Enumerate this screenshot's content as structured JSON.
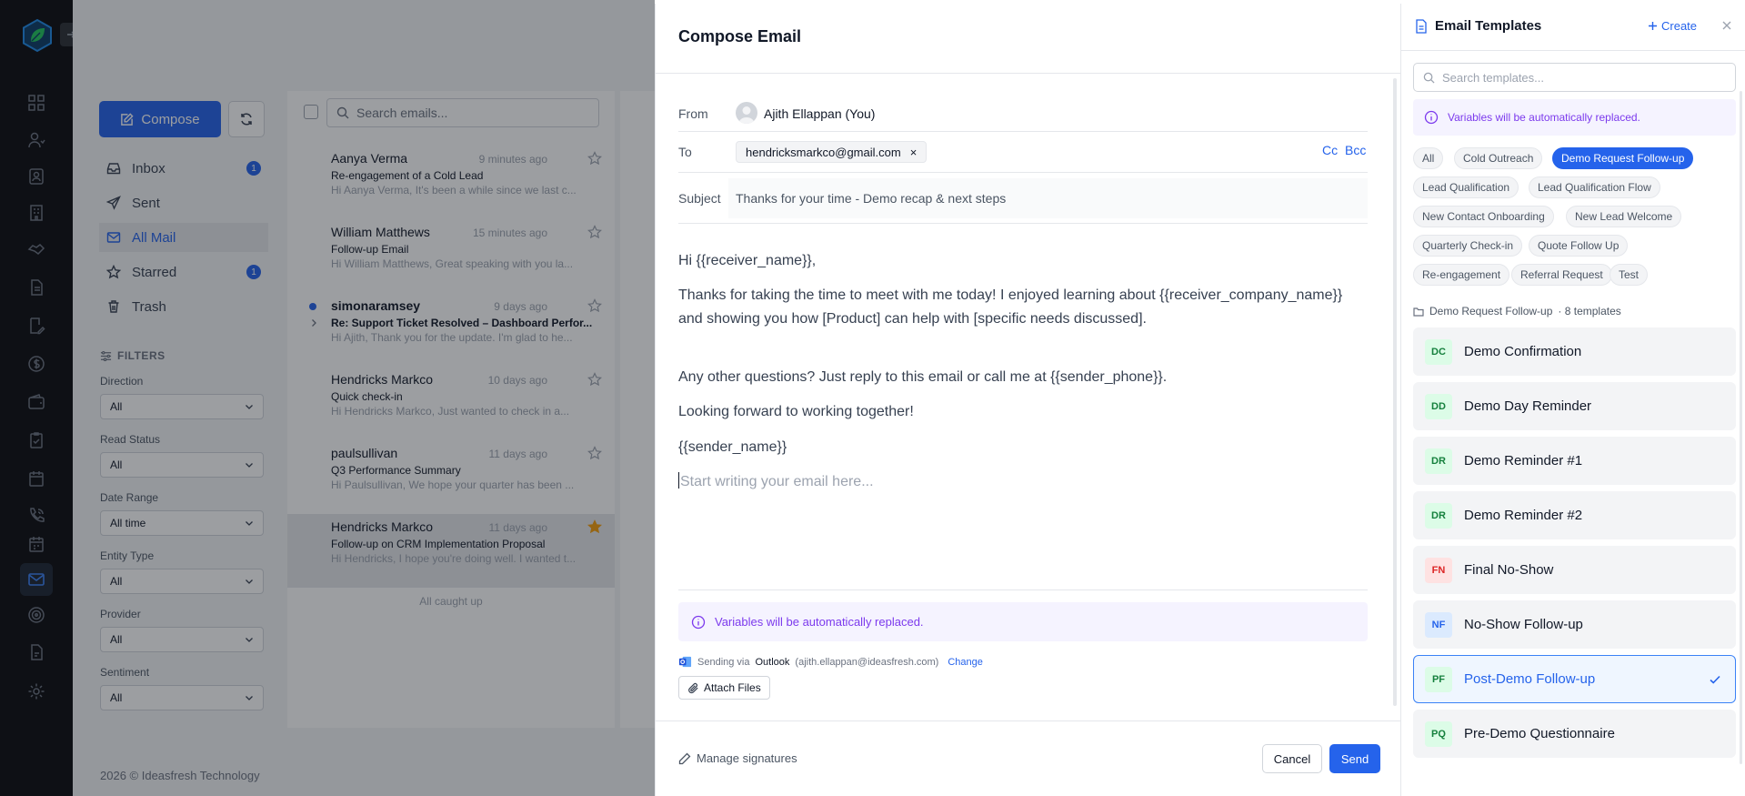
{
  "sidebar": {
    "compose_label": "Compose",
    "nav": [
      {
        "label": "Inbox",
        "badge": "1"
      },
      {
        "label": "Sent",
        "badge": ""
      },
      {
        "label": "All Mail",
        "badge": ""
      },
      {
        "label": "Starred",
        "badge": "1"
      },
      {
        "label": "Trash",
        "badge": ""
      }
    ],
    "filters_heading": "FILTERS",
    "filters": [
      {
        "label": "Direction",
        "value": "All"
      },
      {
        "label": "Read Status",
        "value": "All"
      },
      {
        "label": "Date Range",
        "value": "All time"
      },
      {
        "label": "Entity Type",
        "value": "All"
      },
      {
        "label": "Provider",
        "value": "All"
      },
      {
        "label": "Sentiment",
        "value": "All"
      }
    ],
    "footer": "2026 ©  Ideasfresh Technology"
  },
  "mail_list": {
    "search_placeholder": "Search emails...",
    "items": [
      {
        "from": "Aanya Verma",
        "time": "9 minutes ago",
        "subject": "Re-engagement of a Cold Lead",
        "preview": "Hi Aanya Verma, It's been a while since we last c...",
        "unread": false,
        "starred": false
      },
      {
        "from": "William Matthews",
        "time": "15 minutes ago",
        "subject": "Follow-up Email",
        "preview": "Hi William Matthews, Great speaking with you la...",
        "unread": false,
        "starred": false
      },
      {
        "from": "simonaramsey",
        "time": "9 days ago",
        "subject": "Re: Support Ticket Resolved – Dashboard Perfor...",
        "preview": "Hi Ajith, Thank you for the update. I'm glad to he...",
        "unread": true,
        "starred": false
      },
      {
        "from": "Hendricks Markco",
        "time": "10 days ago",
        "subject": "Quick check-in",
        "preview": "Hi Hendricks Markco, Just wanted to check in a...",
        "unread": false,
        "starred": false
      },
      {
        "from": "paulsullivan",
        "time": "11 days ago",
        "subject": "Q3 Performance Summary",
        "preview": "Hi Paulsullivan, We hope your quarter has been ...",
        "unread": false,
        "starred": false
      },
      {
        "from": "Hendricks Markco",
        "time": "11 days ago",
        "subject": "Follow-up on CRM Implementation Proposal",
        "preview": "Hi Hendricks, I hope you're doing well. I wanted t...",
        "unread": false,
        "starred": true
      }
    ],
    "end_text": "All caught up"
  },
  "compose": {
    "title": "Compose Email",
    "from_label": "From",
    "from_value": "Ajith Ellappan (You)",
    "to_label": "To",
    "to_chip": "hendricksmarkco@gmail.com",
    "chip_remove": "×",
    "cc_label": "Cc",
    "bcc_label": "Bcc",
    "subject_label": "Subject",
    "subject_value": "Thanks for your time - Demo recap & next steps",
    "body": [
      "Hi {{receiver_name}},",
      "Thanks for taking the time to meet with me today! I enjoyed learning about {{receiver_company_name}} and showing you how [Product] can help with [specific needs discussed].",
      "Any other questions? Just reply to this email or call me at {{sender_phone}}.",
      "Looking forward to working together!",
      "{{sender_name}}"
    ],
    "body_placeholder": "Start writing your email here...",
    "variables_note": "Variables will be automatically replaced.",
    "sending_prefix": "Sending via",
    "sending_provider": "Outlook",
    "sending_account": "(ajith.ellappan@ideasfresh.com)",
    "change_label": "Change",
    "attach_label": "Attach Files",
    "manage_signatures": "Manage signatures",
    "cancel_label": "Cancel",
    "send_label": "Send"
  },
  "templates": {
    "title": "Email Templates",
    "create_label": "Create",
    "search_placeholder": "Search templates...",
    "variables_note": "Variables will be automatically replaced.",
    "categories": [
      "All",
      "Cold Outreach",
      "Demo Request Follow-up",
      "Lead Qualification",
      "Lead Qualification Flow",
      "New Contact Onboarding",
      "New Lead Welcome",
      "Quarterly Check-in",
      "Quote Follow Up",
      "Re-engagement",
      "Referral Request",
      "Test"
    ],
    "active_category": "Demo Request Follow-up",
    "crumb_category": "Demo Request Follow-up",
    "crumb_count": "· 8 templates",
    "items": [
      {
        "initials": "DC",
        "name": "Demo Confirmation",
        "color": "#15803d",
        "bg": "#dcfce7"
      },
      {
        "initials": "DD",
        "name": "Demo Day Reminder",
        "color": "#15803d",
        "bg": "#dcfce7"
      },
      {
        "initials": "DR",
        "name": "Demo Reminder #1",
        "color": "#15803d",
        "bg": "#dcfce7"
      },
      {
        "initials": "DR",
        "name": "Demo Reminder #2",
        "color": "#15803d",
        "bg": "#dcfce7"
      },
      {
        "initials": "FN",
        "name": "Final No-Show",
        "color": "#dc2626",
        "bg": "#fee2e2"
      },
      {
        "initials": "NF",
        "name": "No-Show Follow-up",
        "color": "#2563eb",
        "bg": "#dbeafe"
      },
      {
        "initials": "PF",
        "name": "Post-Demo Follow-up",
        "color": "#15803d",
        "bg": "#dcfce7"
      },
      {
        "initials": "PQ",
        "name": "Pre-Demo Questionnaire",
        "color": "#15803d",
        "bg": "#dcfce7"
      }
    ],
    "selected_template": "Post-Demo Follow-up"
  },
  "colors": {
    "accent": "#2563eb",
    "variable_note": "#7c3aed",
    "starred": "#f59e0b"
  }
}
